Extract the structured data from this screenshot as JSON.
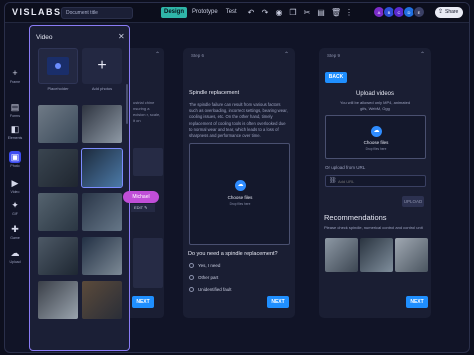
{
  "app": {
    "logo": "VISLABS.",
    "document_title": "Document title"
  },
  "topbar": {
    "modes": [
      "Design",
      "Prototype",
      "Test"
    ],
    "active_mode": "Design",
    "tool_icons": [
      "undo-icon",
      "redo-icon",
      "eye-icon",
      "copy-icon",
      "cut-icon",
      "paste-icon",
      "delete-icon",
      "more-icon"
    ],
    "tool_glyphs": [
      "↶",
      "↷",
      "◉",
      "❐",
      "✂",
      "▤",
      "🗑",
      "⋮"
    ],
    "avatars": [
      {
        "initials": "A",
        "color": "#7b2cc9"
      },
      {
        "initials": "B",
        "color": "#2c4fd6"
      },
      {
        "initials": "C",
        "color": "#5a2ad0"
      },
      {
        "initials": "D",
        "color": "#1f6fe0"
      },
      {
        "initials": "E",
        "color": "#3a3f64"
      }
    ],
    "share_label": "Share"
  },
  "rail": [
    {
      "icon": "add-icon",
      "glyph": "+",
      "label": "Frame"
    },
    {
      "icon": "form-icon",
      "glyph": "▤",
      "label": "Forms"
    },
    {
      "icon": "elements-icon",
      "glyph": "◧",
      "label": "Elements"
    },
    {
      "icon": "photo-icon",
      "glyph": "▣",
      "label": "Photo",
      "active": true
    },
    {
      "icon": "video-icon",
      "glyph": "▶",
      "label": "Video"
    },
    {
      "icon": "gif-icon",
      "glyph": "✦",
      "label": "GIF"
    },
    {
      "icon": "game-icon",
      "glyph": "✚",
      "label": "Game"
    },
    {
      "icon": "upload-icon",
      "glyph": "☁",
      "label": "Upload"
    }
  ],
  "modal": {
    "title": "Video",
    "placeholder_label": "Placeholder",
    "add_photos_label": "Add photos",
    "tooltip": "Michael",
    "edit_label": "EDIT ✎",
    "photo_colors": [
      [
        "#6f7a86",
        "#3b4a5a"
      ],
      [
        "#2e3440",
        "#8f9aa6"
      ],
      [
        "#3a4550",
        "#1f2630"
      ],
      [
        "#1c2a3c",
        "#4c7aa8"
      ],
      [
        "#55636f",
        "#2a3642"
      ],
      [
        "#2a3648",
        "#667788"
      ],
      [
        "#4d5966",
        "#1e2732"
      ],
      [
        "#223044",
        "#7d8a96"
      ],
      [
        "#3a3f48",
        "#9aa4ae"
      ],
      [
        "#5b4a3a",
        "#2a2e38"
      ]
    ]
  },
  "phone_bg": {
    "text": "ustrial chine nsuring a ecision r, scale, it on",
    "next_label": "NEXT"
  },
  "phone_step6": {
    "step": "Step 6",
    "heading": "Spindle replacement",
    "paragraph": "The spindle failure can result from various factors such as overloading, incorrect settings, bearing wear, cooling issues, etc. On the other hand, timely replacement of cooling tools is often overlooked due to normal wear and tear, which leads to a loss of sharpness and performance over time.",
    "choose_files": "Choose files",
    "choose_sub": "Drop files here",
    "question": "Do you need a spindle replacement?",
    "options": [
      "Yes, I need",
      "Other part",
      "Unidentified fault"
    ],
    "next_label": "NEXT"
  },
  "phone_step9": {
    "step": "Step 9",
    "back_label": "BACK",
    "upload_title": "Upload videos",
    "upload_desc": "You will be allowed only MP4, animated gifs, WebM, Ogg",
    "choose_files": "Choose files",
    "choose_sub": "Drop files here",
    "url_label": "Or upload from URL",
    "url_placeholder": "Add URL",
    "upload_label": "UPLOAD",
    "rec_title": "Recommendations",
    "rec_desc": "Please check spindle, numerical control and control unit",
    "rec_colors": [
      [
        "#8d98a4",
        "#3c4652"
      ],
      [
        "#2a3440",
        "#7f8e9c"
      ],
      [
        "#a0a8b2",
        "#4a5560"
      ]
    ],
    "next_label": "NEXT"
  }
}
